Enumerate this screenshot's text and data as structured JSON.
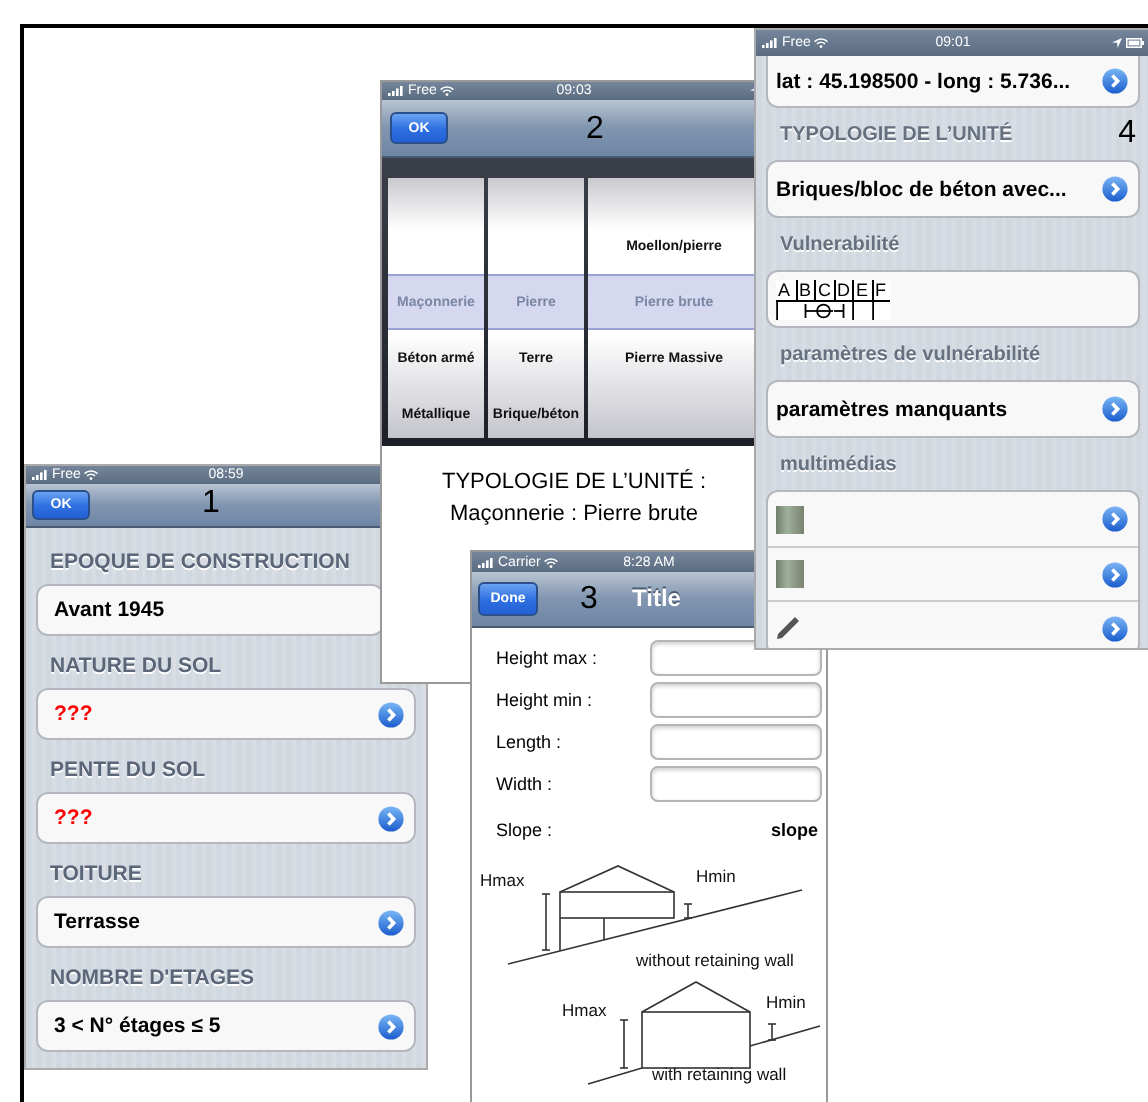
{
  "screen_1": {
    "status_bar": {
      "carrier": "Free",
      "time": "08:59"
    },
    "nav_bar": {
      "button": "OK",
      "number": "1"
    },
    "sections": [
      {
        "header": "EPOQUE DE CONSTRUCTION",
        "value": "Avant 1945",
        "missing": false
      },
      {
        "header": "NATURE DU SOL",
        "value": "???",
        "missing": true
      },
      {
        "header": "PENTE DU SOL",
        "value": "???",
        "missing": true
      },
      {
        "header": "TOITURE",
        "value": "Terrasse",
        "missing": false
      },
      {
        "header": "NOMBRE D'ETAGES",
        "value": "3 < N° étages ≤ 5",
        "missing": false
      }
    ]
  },
  "screen_2": {
    "status_bar": {
      "carrier": "Free",
      "time": "09:03"
    },
    "nav_bar": {
      "button": "OK",
      "number": "2"
    },
    "picker": {
      "columns": [
        {
          "items": [
            {
              "label": "Maçonnerie",
              "selected": true
            },
            {
              "label": "Béton armé",
              "selected": false
            },
            {
              "label": "Métallique",
              "selected": false
            }
          ]
        },
        {
          "items": [
            {
              "label": "Pierre",
              "selected": true
            },
            {
              "label": "Terre",
              "selected": false
            },
            {
              "label": "Brique/béton",
              "selected": false
            }
          ]
        },
        {
          "items": [
            {
              "label": "Moellon/pierre",
              "selected": false
            },
            {
              "label": "Pierre brute",
              "selected": true
            },
            {
              "label": "Pierre Massive",
              "selected": false
            }
          ]
        }
      ]
    },
    "summary": [
      "TYPOLOGIE DE L’UNITÉ :",
      "Maçonnerie : Pierre brute"
    ]
  },
  "screen_3": {
    "status_bar": {
      "carrier": "Carrier",
      "time": "8:28 AM"
    },
    "nav_bar": {
      "button": "Done",
      "number": "3",
      "title": "Title"
    },
    "fields": [
      {
        "label": "Height max :"
      },
      {
        "label": "Height min :"
      },
      {
        "label": "Length :"
      },
      {
        "label": "Width :"
      }
    ],
    "slope": {
      "label": "Slope :",
      "value": "slope"
    },
    "diagrams": [
      {
        "kind": "without_wall",
        "hmax": "Hmax",
        "hmin": "Hmin",
        "caption": "without retaining wall"
      },
      {
        "kind": "with_wall",
        "hmax": "Hmax",
        "hmin": "Hmin",
        "caption": "with retaining wall"
      }
    ]
  },
  "screen_4": {
    "status_bar": {
      "carrier": "Free",
      "time": "09:01"
    },
    "groups": [
      {
        "rows": [
          {
            "kind": "text",
            "text": "lat : 45.198500 - long : 5.736..."
          }
        ]
      },
      {
        "header": "TYPOLOGIE DE L’UNITÉ",
        "number": "4",
        "rows": [
          {
            "kind": "text",
            "text": "Briques/bloc de béton avec..."
          }
        ]
      },
      {
        "header": "Vulnerabilité",
        "rows": [
          {
            "kind": "scale",
            "classes": [
              {
                "label": "A",
                "in_range": false,
                "likely": false
              },
              {
                "label": "B",
                "in_range": true,
                "likely": false
              },
              {
                "label": "C",
                "in_range": true,
                "likely": true
              },
              {
                "label": "D",
                "in_range": true,
                "likely": false
              },
              {
                "label": "E",
                "in_range": false,
                "likely": false
              },
              {
                "label": "F",
                "in_range": false,
                "likely": false
              }
            ]
          }
        ]
      },
      {
        "header": "paramètres de vulnérabilité",
        "rows": [
          {
            "kind": "text",
            "text": "paramètres manquants"
          }
        ]
      },
      {
        "header": "multimédias",
        "rows": [
          {
            "kind": "photo"
          },
          {
            "kind": "photo"
          },
          {
            "kind": "pencil"
          }
        ]
      }
    ]
  }
}
